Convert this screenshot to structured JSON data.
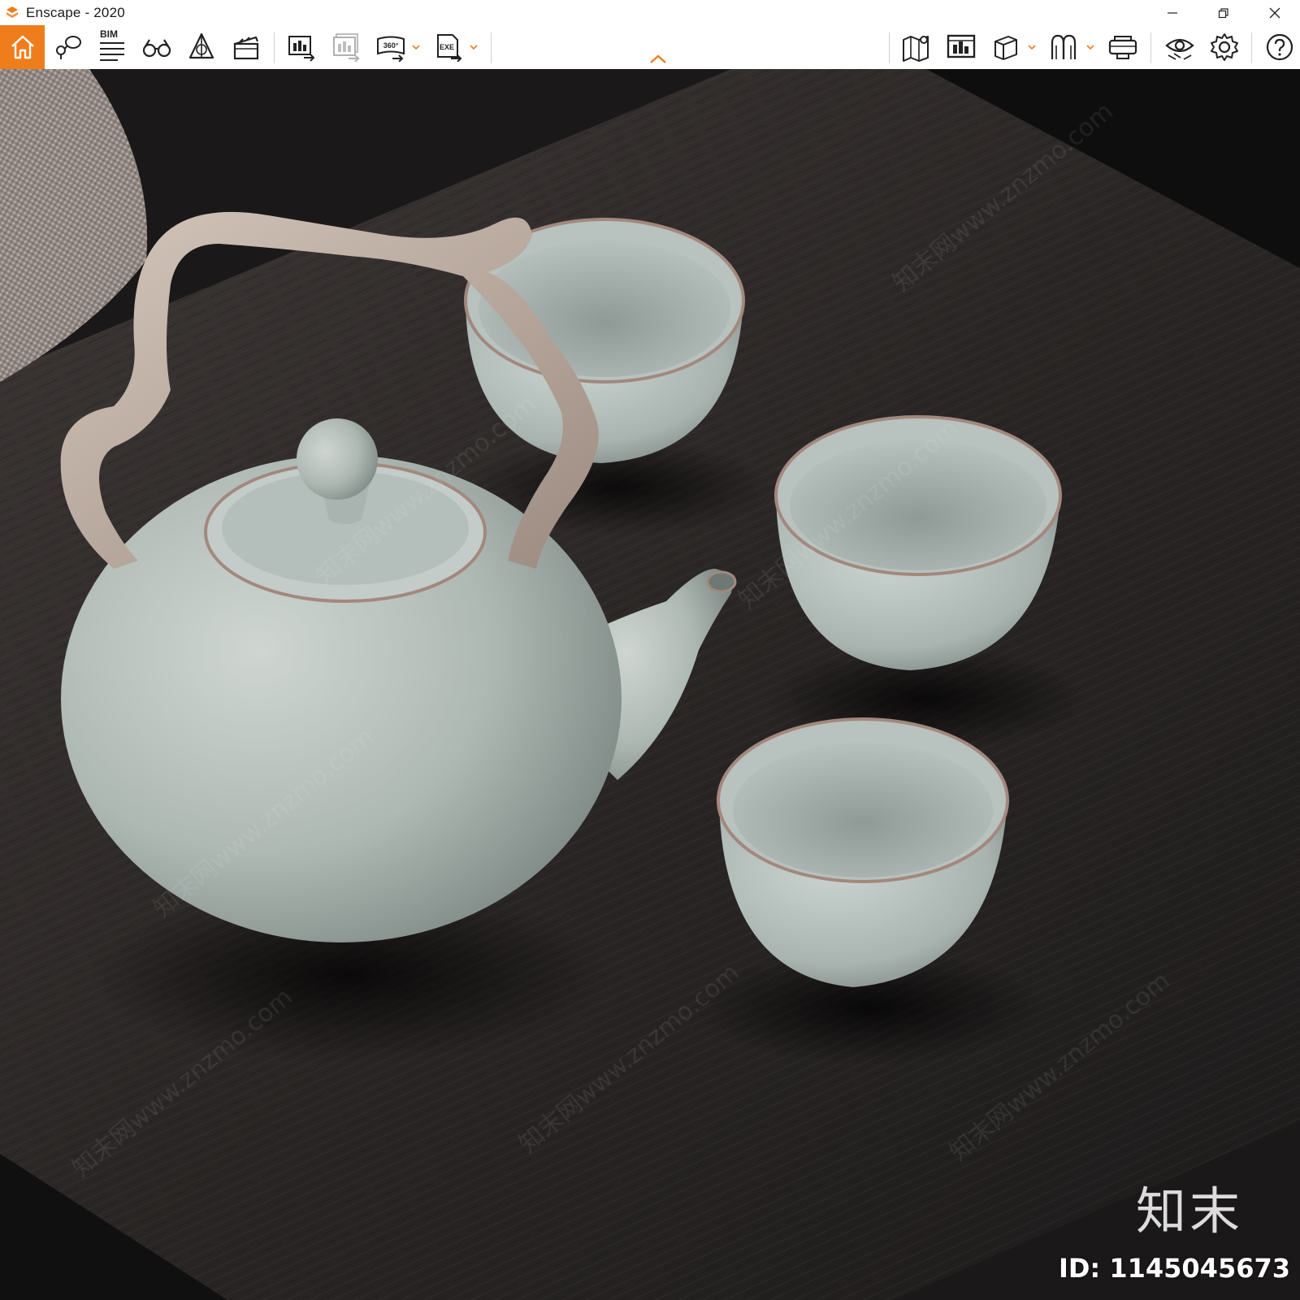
{
  "window": {
    "title": "Enscape - 2020",
    "app_icon": "enscape-logo-icon",
    "controls": [
      "minimize-icon",
      "restore-icon",
      "close-icon"
    ]
  },
  "toolbar": {
    "accent_color": "#f07d1c",
    "bim_label": "BIM",
    "left_group": [
      {
        "name": "home",
        "icon": "home-icon",
        "active": true
      },
      {
        "name": "views",
        "icon": "pin-and-bubble-icon"
      },
      {
        "name": "bim-info",
        "icon": "bim-list-icon"
      },
      {
        "name": "asset-library",
        "icon": "binoculars-icon"
      },
      {
        "name": "material-editor",
        "icon": "pyramid-icon"
      },
      {
        "name": "video-editor",
        "icon": "clapperboard-icon"
      }
    ],
    "export_group": [
      {
        "name": "render-screenshot",
        "icon": "image-export-icon"
      },
      {
        "name": "batch-render",
        "icon": "batch-image-export-icon",
        "disabled": true
      },
      {
        "name": "panorama-360",
        "icon": "panorama-360-icon",
        "label": "360°",
        "has_dropdown": true
      },
      {
        "name": "export-exe",
        "icon": "exe-export-icon",
        "label": "EXE",
        "has_dropdown": true
      }
    ],
    "right_group": [
      {
        "name": "minimap",
        "icon": "map-pin-icon"
      },
      {
        "name": "sync-views",
        "icon": "image-sync-icon"
      },
      {
        "name": "view-mode",
        "icon": "cube-icon",
        "has_dropdown": true
      },
      {
        "name": "objects",
        "icon": "arches-icon",
        "has_dropdown": true
      },
      {
        "name": "vr-headset",
        "icon": "vr-headset-icon"
      },
      {
        "name": "visibility",
        "icon": "eye-icon"
      },
      {
        "name": "settings",
        "icon": "gear-icon"
      },
      {
        "name": "help",
        "icon": "help-icon",
        "label": "?"
      }
    ],
    "collapse_icon": "chevron-up-icon"
  },
  "viewport": {
    "scene": "tea-set-render",
    "brand_watermark": "知末",
    "id_watermark": "ID: 1145045673",
    "repeating_watermark": "知末网www.znzmo.com"
  }
}
